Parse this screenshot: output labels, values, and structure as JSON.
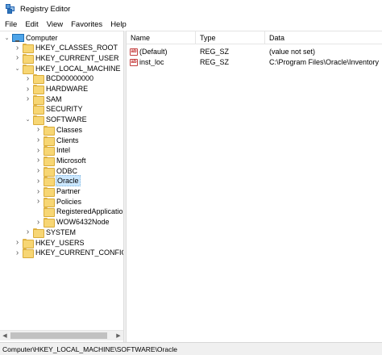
{
  "window": {
    "title": "Registry Editor",
    "icon": "registry-editor-icon"
  },
  "menu": [
    "File",
    "Edit",
    "View",
    "Favorites",
    "Help"
  ],
  "tree": [
    {
      "label": "Computer",
      "depth": 0,
      "state": "expanded",
      "icon": "computer-icon"
    },
    {
      "label": "HKEY_CLASSES_ROOT",
      "depth": 1,
      "state": "collapsed",
      "icon": "folder-icon"
    },
    {
      "label": "HKEY_CURRENT_USER",
      "depth": 1,
      "state": "collapsed",
      "icon": "folder-icon"
    },
    {
      "label": "HKEY_LOCAL_MACHINE",
      "depth": 1,
      "state": "expanded",
      "icon": "folder-icon"
    },
    {
      "label": "BCD00000000",
      "depth": 2,
      "state": "collapsed",
      "icon": "folder-icon"
    },
    {
      "label": "HARDWARE",
      "depth": 2,
      "state": "collapsed",
      "icon": "folder-icon"
    },
    {
      "label": "SAM",
      "depth": 2,
      "state": "collapsed",
      "icon": "folder-icon"
    },
    {
      "label": "SECURITY",
      "depth": 2,
      "state": "leaf",
      "icon": "folder-icon"
    },
    {
      "label": "SOFTWARE",
      "depth": 2,
      "state": "expanded",
      "icon": "folder-icon"
    },
    {
      "label": "Classes",
      "depth": 3,
      "state": "collapsed",
      "icon": "folder-icon"
    },
    {
      "label": "Clients",
      "depth": 3,
      "state": "collapsed",
      "icon": "folder-icon"
    },
    {
      "label": "Intel",
      "depth": 3,
      "state": "collapsed",
      "icon": "folder-icon"
    },
    {
      "label": "Microsoft",
      "depth": 3,
      "state": "collapsed",
      "icon": "folder-icon"
    },
    {
      "label": "ODBC",
      "depth": 3,
      "state": "collapsed",
      "icon": "folder-icon"
    },
    {
      "label": "Oracle",
      "depth": 3,
      "state": "collapsed",
      "icon": "folder-icon",
      "selected": true
    },
    {
      "label": "Partner",
      "depth": 3,
      "state": "collapsed",
      "icon": "folder-icon"
    },
    {
      "label": "Policies",
      "depth": 3,
      "state": "collapsed",
      "icon": "folder-icon"
    },
    {
      "label": "RegisteredApplication",
      "depth": 3,
      "state": "leaf",
      "icon": "folder-icon"
    },
    {
      "label": "WOW6432Node",
      "depth": 3,
      "state": "collapsed",
      "icon": "folder-icon"
    },
    {
      "label": "SYSTEM",
      "depth": 2,
      "state": "collapsed",
      "icon": "folder-icon"
    },
    {
      "label": "HKEY_USERS",
      "depth": 1,
      "state": "collapsed",
      "icon": "folder-icon"
    },
    {
      "label": "HKEY_CURRENT_CONFIG",
      "depth": 1,
      "state": "collapsed",
      "icon": "folder-icon"
    }
  ],
  "list": {
    "columns": [
      "Name",
      "Type",
      "Data"
    ],
    "rows": [
      {
        "name": "(Default)",
        "type": "REG_SZ",
        "data": "(value not set)",
        "icon": "string-value-icon"
      },
      {
        "name": "inst_loc",
        "type": "REG_SZ",
        "data": "C:\\Program Files\\Oracle\\Inventory",
        "icon": "string-value-icon"
      }
    ]
  },
  "status": {
    "path": "Computer\\HKEY_LOCAL_MACHINE\\SOFTWARE\\Oracle"
  },
  "colors": {
    "selection": "#cce8ff",
    "folder": "#f7d674",
    "computer": "#4ea4e8",
    "value_icon": "#c02020"
  }
}
